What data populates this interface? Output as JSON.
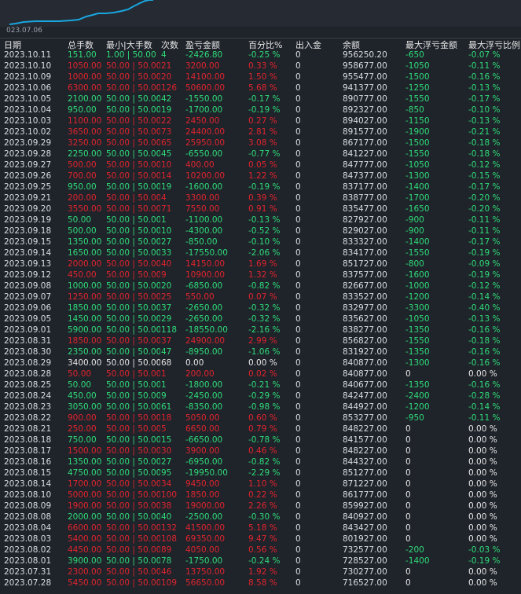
{
  "chart": {
    "date_label": "023.07.06",
    "line_color": "#19a6e0"
  },
  "headers": [
    "日期",
    "总手数",
    "最小|大手数",
    "次数",
    "盈亏金额",
    "百分比%",
    "出入金",
    "余额",
    "最大浮亏金额",
    "最大浮亏比例"
  ],
  "colors": {
    "green": "#2fdc7a",
    "red": "#e0242e",
    "white": "#e6e6e6"
  },
  "rows": [
    {
      "date": "2023.10.11",
      "total": "151.00",
      "lots": "1.00 | 50.00",
      "count": "4",
      "pnl": "-2426.80",
      "pct": "-0.25 %",
      "flow": "0",
      "balance": "956250.20",
      "dd": "-650",
      "ddpct": "-0.07 %",
      "color": "green"
    },
    {
      "date": "2023.10.10",
      "total": "1050.00",
      "lots": "50.00 | 50.00",
      "count": "21",
      "pnl": "3200.00",
      "pct": "0.33 %",
      "flow": "0",
      "balance": "958677.00",
      "dd": "-1050",
      "ddpct": "-0.11 %",
      "color": "red"
    },
    {
      "date": "2023.10.09",
      "total": "1000.00",
      "lots": "50.00 | 50.00",
      "count": "20",
      "pnl": "14100.00",
      "pct": "1.50 %",
      "flow": "0",
      "balance": "955477.00",
      "dd": "-1500",
      "ddpct": "-0.16 %",
      "color": "red"
    },
    {
      "date": "2023.10.06",
      "total": "6300.00",
      "lots": "50.00 | 50.00",
      "count": "126",
      "pnl": "50600.00",
      "pct": "5.68 %",
      "flow": "0",
      "balance": "941377.00",
      "dd": "-1250",
      "ddpct": "-0.13 %",
      "color": "red"
    },
    {
      "date": "2023.10.05",
      "total": "2100.00",
      "lots": "50.00 | 50.00",
      "count": "42",
      "pnl": "-1550.00",
      "pct": "-0.17 %",
      "flow": "0",
      "balance": "890777.00",
      "dd": "-1550",
      "ddpct": "-0.17 %",
      "color": "green"
    },
    {
      "date": "2023.10.04",
      "total": "950.00",
      "lots": "50.00 | 50.00",
      "count": "19",
      "pnl": "-1700.00",
      "pct": "-0.19 %",
      "flow": "0",
      "balance": "892327.00",
      "dd": "-850",
      "ddpct": "-0.10 %",
      "color": "green"
    },
    {
      "date": "2023.10.03",
      "total": "1100.00",
      "lots": "50.00 | 50.00",
      "count": "22",
      "pnl": "2450.00",
      "pct": "0.27 %",
      "flow": "0",
      "balance": "894027.00",
      "dd": "-1150",
      "ddpct": "-0.13 %",
      "color": "red"
    },
    {
      "date": "2023.10.02",
      "total": "3650.00",
      "lots": "50.00 | 50.00",
      "count": "73",
      "pnl": "24400.00",
      "pct": "2.81 %",
      "flow": "0",
      "balance": "891577.00",
      "dd": "-1900",
      "ddpct": "-0.21 %",
      "color": "red"
    },
    {
      "date": "2023.09.29",
      "total": "3250.00",
      "lots": "50.00 | 50.00",
      "count": "65",
      "pnl": "25950.00",
      "pct": "3.08 %",
      "flow": "0",
      "balance": "867177.00",
      "dd": "-1500",
      "ddpct": "-0.18 %",
      "color": "red"
    },
    {
      "date": "2023.09.28",
      "total": "2250.00",
      "lots": "50.00 | 50.00",
      "count": "45",
      "pnl": "-6550.00",
      "pct": "-0.77 %",
      "flow": "0",
      "balance": "841227.00",
      "dd": "-1550",
      "ddpct": "-0.18 %",
      "color": "green"
    },
    {
      "date": "2023.09.27",
      "total": "500.00",
      "lots": "50.00 | 50.00",
      "count": "10",
      "pnl": "400.00",
      "pct": "0.05 %",
      "flow": "0",
      "balance": "847777.00",
      "dd": "-1050",
      "ddpct": "-0.12 %",
      "color": "red"
    },
    {
      "date": "2023.09.26",
      "total": "700.00",
      "lots": "50.00 | 50.00",
      "count": "14",
      "pnl": "10200.00",
      "pct": "1.22 %",
      "flow": "0",
      "balance": "847377.00",
      "dd": "-1300",
      "ddpct": "-0.15 %",
      "color": "red"
    },
    {
      "date": "2023.09.25",
      "total": "950.00",
      "lots": "50.00 | 50.00",
      "count": "19",
      "pnl": "-1600.00",
      "pct": "-0.19 %",
      "flow": "0",
      "balance": "837177.00",
      "dd": "-1400",
      "ddpct": "-0.17 %",
      "color": "green"
    },
    {
      "date": "2023.09.21",
      "total": "200.00",
      "lots": "50.00 | 50.00",
      "count": "4",
      "pnl": "3300.00",
      "pct": "0.39 %",
      "flow": "0",
      "balance": "838777.00",
      "dd": "-1700",
      "ddpct": "-0.20 %",
      "color": "red"
    },
    {
      "date": "2023.09.20",
      "total": "3550.00",
      "lots": "50.00 | 50.00",
      "count": "71",
      "pnl": "7550.00",
      "pct": "0.91 %",
      "flow": "0",
      "balance": "835477.00",
      "dd": "-1650",
      "ddpct": "-0.20 %",
      "color": "red"
    },
    {
      "date": "2023.09.19",
      "total": "50.00",
      "lots": "50.00 | 50.00",
      "count": "1",
      "pnl": "-1100.00",
      "pct": "-0.13 %",
      "flow": "0",
      "balance": "827927.00",
      "dd": "-900",
      "ddpct": "-0.11 %",
      "color": "green"
    },
    {
      "date": "2023.09.18",
      "total": "500.00",
      "lots": "50.00 | 50.00",
      "count": "10",
      "pnl": "-4300.00",
      "pct": "-0.52 %",
      "flow": "0",
      "balance": "829027.00",
      "dd": "-900",
      "ddpct": "-0.11 %",
      "color": "green"
    },
    {
      "date": "2023.09.15",
      "total": "1350.00",
      "lots": "50.00 | 50.00",
      "count": "27",
      "pnl": "-850.00",
      "pct": "-0.10 %",
      "flow": "0",
      "balance": "833327.00",
      "dd": "-1400",
      "ddpct": "-0.17 %",
      "color": "green"
    },
    {
      "date": "2023.09.14",
      "total": "1650.00",
      "lots": "50.00 | 50.00",
      "count": "33",
      "pnl": "-17550.00",
      "pct": "-2.06 %",
      "flow": "0",
      "balance": "834177.00",
      "dd": "-1550",
      "ddpct": "-0.19 %",
      "color": "green"
    },
    {
      "date": "2023.09.13",
      "total": "2000.00",
      "lots": "50.00 | 50.00",
      "count": "40",
      "pnl": "14150.00",
      "pct": "1.69 %",
      "flow": "0",
      "balance": "851727.00",
      "dd": "-800",
      "ddpct": "-0.09 %",
      "color": "red"
    },
    {
      "date": "2023.09.12",
      "total": "450.00",
      "lots": "50.00 | 50.00",
      "count": "9",
      "pnl": "10900.00",
      "pct": "1.32 %",
      "flow": "0",
      "balance": "837577.00",
      "dd": "-1600",
      "ddpct": "-0.19 %",
      "color": "red"
    },
    {
      "date": "2023.09.08",
      "total": "1000.00",
      "lots": "50.00 | 50.00",
      "count": "20",
      "pnl": "-6850.00",
      "pct": "-0.82 %",
      "flow": "0",
      "balance": "826677.00",
      "dd": "-1000",
      "ddpct": "-0.12 %",
      "color": "green"
    },
    {
      "date": "2023.09.07",
      "total": "1250.00",
      "lots": "50.00 | 50.00",
      "count": "25",
      "pnl": "550.00",
      "pct": "0.07 %",
      "flow": "0",
      "balance": "833527.00",
      "dd": "-1200",
      "ddpct": "-0.14 %",
      "color": "red"
    },
    {
      "date": "2023.09.06",
      "total": "1850.00",
      "lots": "50.00 | 50.00",
      "count": "37",
      "pnl": "-2650.00",
      "pct": "-0.32 %",
      "flow": "0",
      "balance": "832977.00",
      "dd": "-3300",
      "ddpct": "-0.40 %",
      "color": "green"
    },
    {
      "date": "2023.09.05",
      "total": "1450.00",
      "lots": "50.00 | 50.00",
      "count": "29",
      "pnl": "-2650.00",
      "pct": "-0.32 %",
      "flow": "0",
      "balance": "835627.00",
      "dd": "-1050",
      "ddpct": "-0.13 %",
      "color": "green"
    },
    {
      "date": "2023.09.01",
      "total": "5900.00",
      "lots": "50.00 | 50.00",
      "count": "118",
      "pnl": "-18550.00",
      "pct": "-2.16 %",
      "flow": "0",
      "balance": "838277.00",
      "dd": "-1350",
      "ddpct": "-0.16 %",
      "color": "green"
    },
    {
      "date": "2023.08.31",
      "total": "1850.00",
      "lots": "50.00 | 50.00",
      "count": "37",
      "pnl": "24900.00",
      "pct": "2.99 %",
      "flow": "0",
      "balance": "856827.00",
      "dd": "-1550",
      "ddpct": "-0.18 %",
      "color": "red"
    },
    {
      "date": "2023.08.30",
      "total": "2350.00",
      "lots": "50.00 | 50.00",
      "count": "47",
      "pnl": "-8950.00",
      "pct": "-1.06 %",
      "flow": "0",
      "balance": "831927.00",
      "dd": "-1350",
      "ddpct": "-0.16 %",
      "color": "green"
    },
    {
      "date": "2023.08.29",
      "total": "3400.00",
      "lots": "50.00 | 50.00",
      "count": "68",
      "pnl": "0.00",
      "pct": "0.00 %",
      "flow": "0",
      "balance": "840877.00",
      "dd": "-1300",
      "ddpct": "-0.16 %",
      "color": "white"
    },
    {
      "date": "2023.08.28",
      "total": "50.00",
      "lots": "50.00 | 50.00",
      "count": "1",
      "pnl": "200.00",
      "pct": "0.02 %",
      "flow": "0",
      "balance": "840877.00",
      "dd": "0",
      "ddpct": "0.00 %",
      "color": "red"
    },
    {
      "date": "2023.08.25",
      "total": "50.00",
      "lots": "50.00 | 50.00",
      "count": "1",
      "pnl": "-1800.00",
      "pct": "-0.21 %",
      "flow": "0",
      "balance": "840677.00",
      "dd": "-1350",
      "ddpct": "-0.16 %",
      "color": "green"
    },
    {
      "date": "2023.08.24",
      "total": "450.00",
      "lots": "50.00 | 50.00",
      "count": "9",
      "pnl": "-2450.00",
      "pct": "-0.29 %",
      "flow": "0",
      "balance": "842477.00",
      "dd": "-2400",
      "ddpct": "-0.28 %",
      "color": "green"
    },
    {
      "date": "2023.08.23",
      "total": "3050.00",
      "lots": "50.00 | 50.00",
      "count": "61",
      "pnl": "-8350.00",
      "pct": "-0.98 %",
      "flow": "0",
      "balance": "844927.00",
      "dd": "-1200",
      "ddpct": "-0.14 %",
      "color": "green"
    },
    {
      "date": "2023.08.22",
      "total": "900.00",
      "lots": "50.00 | 50.00",
      "count": "18",
      "pnl": "5050.00",
      "pct": "0.60 %",
      "flow": "0",
      "balance": "853277.00",
      "dd": "-950",
      "ddpct": "-0.11 %",
      "color": "red"
    },
    {
      "date": "2023.08.21",
      "total": "250.00",
      "lots": "50.00 | 50.00",
      "count": "5",
      "pnl": "6650.00",
      "pct": "0.79 %",
      "flow": "0",
      "balance": "848227.00",
      "dd": "0",
      "ddpct": "0.00 %",
      "color": "red"
    },
    {
      "date": "2023.08.18",
      "total": "750.00",
      "lots": "50.00 | 50.00",
      "count": "15",
      "pnl": "-6650.00",
      "pct": "-0.78 %",
      "flow": "0",
      "balance": "841577.00",
      "dd": "0",
      "ddpct": "0.00 %",
      "color": "green"
    },
    {
      "date": "2023.08.17",
      "total": "1500.00",
      "lots": "50.00 | 50.00",
      "count": "30",
      "pnl": "3900.00",
      "pct": "0.46 %",
      "flow": "0",
      "balance": "848227.00",
      "dd": "0",
      "ddpct": "0.00 %",
      "color": "red"
    },
    {
      "date": "2023.08.16",
      "total": "1350.00",
      "lots": "50.00 | 50.00",
      "count": "27",
      "pnl": "-6950.00",
      "pct": "-0.82 %",
      "flow": "0",
      "balance": "844327.00",
      "dd": "0",
      "ddpct": "0.00 %",
      "color": "green"
    },
    {
      "date": "2023.08.15",
      "total": "4750.00",
      "lots": "50.00 | 50.00",
      "count": "95",
      "pnl": "-19950.00",
      "pct": "-2.29 %",
      "flow": "0",
      "balance": "851277.00",
      "dd": "0",
      "ddpct": "0.00 %",
      "color": "green"
    },
    {
      "date": "2023.08.14",
      "total": "1700.00",
      "lots": "50.00 | 50.00",
      "count": "34",
      "pnl": "9450.00",
      "pct": "1.10 %",
      "flow": "0",
      "balance": "871227.00",
      "dd": "0",
      "ddpct": "0.00 %",
      "color": "red"
    },
    {
      "date": "2023.08.10",
      "total": "5000.00",
      "lots": "50.00 | 50.00",
      "count": "100",
      "pnl": "1850.00",
      "pct": "0.22 %",
      "flow": "0",
      "balance": "861777.00",
      "dd": "0",
      "ddpct": "0.00 %",
      "color": "red"
    },
    {
      "date": "2023.08.09",
      "total": "1900.00",
      "lots": "50.00 | 50.00",
      "count": "38",
      "pnl": "19000.00",
      "pct": "2.26 %",
      "flow": "0",
      "balance": "859927.00",
      "dd": "0",
      "ddpct": "0.00 %",
      "color": "red"
    },
    {
      "date": "2023.08.08",
      "total": "2000.00",
      "lots": "50.00 | 50.00",
      "count": "40",
      "pnl": "-2500.00",
      "pct": "-0.30 %",
      "flow": "0",
      "balance": "840927.00",
      "dd": "0",
      "ddpct": "0.00 %",
      "color": "green"
    },
    {
      "date": "2023.08.04",
      "total": "6600.00",
      "lots": "50.00 | 50.00",
      "count": "132",
      "pnl": "41500.00",
      "pct": "5.18 %",
      "flow": "0",
      "balance": "843427.00",
      "dd": "0",
      "ddpct": "0.00 %",
      "color": "red"
    },
    {
      "date": "2023.08.03",
      "total": "5400.00",
      "lots": "50.00 | 50.00",
      "count": "108",
      "pnl": "69350.00",
      "pct": "9.47 %",
      "flow": "0",
      "balance": "801927.00",
      "dd": "0",
      "ddpct": "0.00 %",
      "color": "red"
    },
    {
      "date": "2023.08.02",
      "total": "4450.00",
      "lots": "50.00 | 50.00",
      "count": "89",
      "pnl": "4050.00",
      "pct": "0.56 %",
      "flow": "0",
      "balance": "732577.00",
      "dd": "-200",
      "ddpct": "-0.03 %",
      "color": "red"
    },
    {
      "date": "2023.08.01",
      "total": "3900.00",
      "lots": "50.00 | 50.00",
      "count": "78",
      "pnl": "-1750.00",
      "pct": "-0.24 %",
      "flow": "0",
      "balance": "728527.00",
      "dd": "-1400",
      "ddpct": "-0.19 %",
      "color": "green"
    },
    {
      "date": "2023.07.31",
      "total": "2300.00",
      "lots": "50.00 | 50.00",
      "count": "46",
      "pnl": "13750.00",
      "pct": "1.92 %",
      "flow": "0",
      "balance": "730277.00",
      "dd": "0",
      "ddpct": "0.00 %",
      "color": "red"
    },
    {
      "date": "2023.07.28",
      "total": "5450.00",
      "lots": "50.00 | 50.00",
      "count": "109",
      "pnl": "56650.00",
      "pct": "8.58 %",
      "flow": "0",
      "balance": "716527.00",
      "dd": "0",
      "ddpct": "0.00 %",
      "color": "red"
    }
  ]
}
